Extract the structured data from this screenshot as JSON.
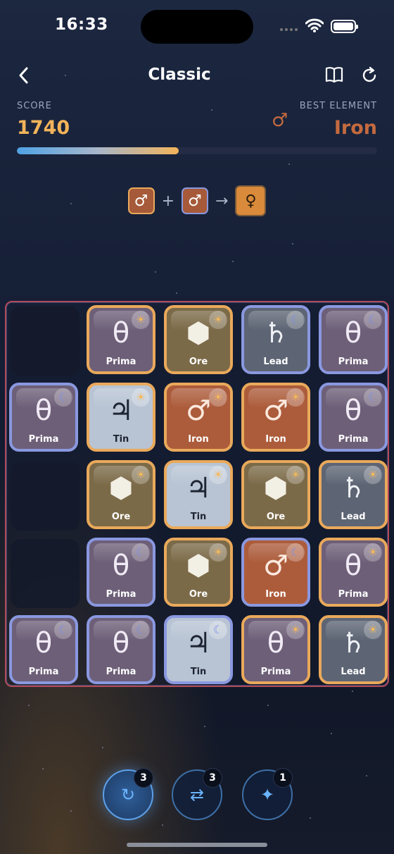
{
  "status_bar": {
    "time": "16:33"
  },
  "nav": {
    "title": "Classic"
  },
  "score": {
    "label": "SCORE",
    "value": "1740",
    "progress_percent": 45
  },
  "best": {
    "label": "BEST ELEMENT",
    "value": "Iron",
    "symbol": "♂"
  },
  "recipe": {
    "a": "♂",
    "plus": "+",
    "b": "♂",
    "arrow": "→",
    "result": "♀"
  },
  "board": {
    "rows": [
      [
        null,
        {
          "label": "Prima",
          "symbol": "θ",
          "kind": "prima",
          "phase": "sun"
        },
        {
          "label": "Ore",
          "symbol": "⬢",
          "kind": "ore",
          "phase": "sun"
        },
        {
          "label": "Lead",
          "symbol": "♄",
          "kind": "lead",
          "phase": "moon"
        },
        {
          "label": "Prima",
          "symbol": "θ",
          "kind": "prima",
          "phase": "moon"
        }
      ],
      [
        {
          "label": "Prima",
          "symbol": "θ",
          "kind": "prima",
          "phase": "moon"
        },
        {
          "label": "Tin",
          "symbol": "♃",
          "kind": "tin",
          "phase": "sun"
        },
        {
          "label": "Iron",
          "symbol": "♂",
          "kind": "iron",
          "phase": "sun"
        },
        {
          "label": "Iron",
          "symbol": "♂",
          "kind": "iron",
          "phase": "sun"
        },
        {
          "label": "Prima",
          "symbol": "θ",
          "kind": "prima",
          "phase": "moon"
        }
      ],
      [
        null,
        {
          "label": "Ore",
          "symbol": "⬢",
          "kind": "ore",
          "phase": "sun"
        },
        {
          "label": "Tin",
          "symbol": "♃",
          "kind": "tin",
          "phase": "sun"
        },
        {
          "label": "Ore",
          "symbol": "⬢",
          "kind": "ore",
          "phase": "sun"
        },
        {
          "label": "Lead",
          "symbol": "♄",
          "kind": "lead",
          "phase": "sun"
        }
      ],
      [
        null,
        {
          "label": "Prima",
          "symbol": "θ",
          "kind": "prima",
          "phase": "moon"
        },
        {
          "label": "Ore",
          "symbol": "⬢",
          "kind": "ore",
          "phase": "sun"
        },
        {
          "label": "Iron",
          "symbol": "♂",
          "kind": "iron",
          "phase": "moon"
        },
        {
          "label": "Prima",
          "symbol": "θ",
          "kind": "prima",
          "phase": "sun"
        }
      ],
      [
        {
          "label": "Prima",
          "symbol": "θ",
          "kind": "prima",
          "phase": "moon"
        },
        {
          "label": "Prima",
          "symbol": "θ",
          "kind": "prima",
          "phase": "moon"
        },
        {
          "label": "Tin",
          "symbol": "♃",
          "kind": "tin",
          "phase": "moon"
        },
        {
          "label": "Prima",
          "symbol": "θ",
          "kind": "prima",
          "phase": "sun"
        },
        {
          "label": "Lead",
          "symbol": "♄",
          "kind": "lead",
          "phase": "sun"
        }
      ]
    ]
  },
  "boosters": [
    {
      "name": "undo",
      "icon": "undo-icon",
      "count": "3",
      "active": true
    },
    {
      "name": "swap",
      "icon": "swap-icon",
      "count": "3",
      "active": false
    },
    {
      "name": "sparkle",
      "icon": "sparkle-icon",
      "count": "1",
      "active": false
    }
  ],
  "colors": {
    "score": "#f2b35a",
    "best": "#c56a3f",
    "sun_border": "#e9a95b",
    "moon_border": "#8a98e0",
    "board_border": "#b14a5a"
  }
}
